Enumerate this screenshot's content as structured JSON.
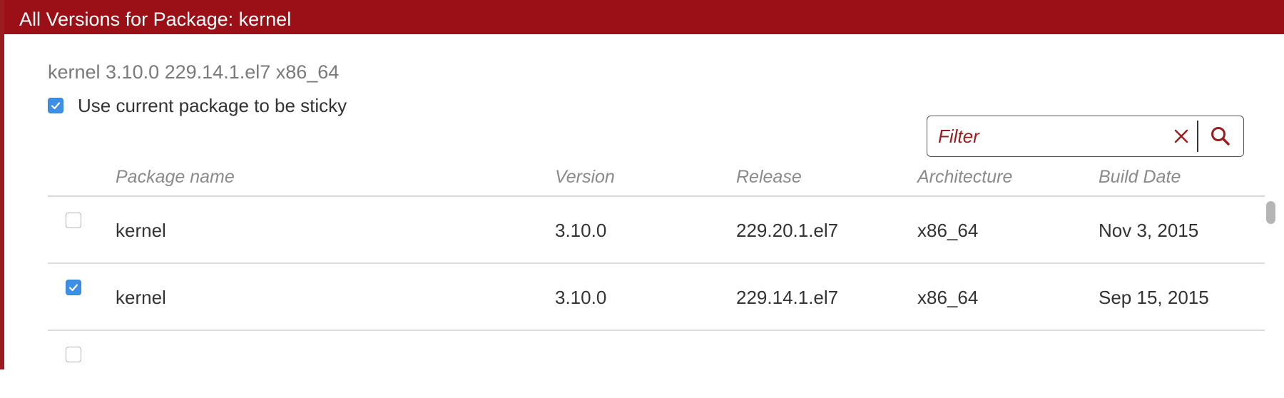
{
  "dialog": {
    "title": "All Versions for Package: kernel",
    "subtitle": "kernel 3.10.0 229.14.1.el7 x86_64",
    "sticky_label": "Use current package to be sticky",
    "sticky_checked": true
  },
  "filter": {
    "placeholder": "Filter",
    "value": "",
    "clear_icon": "close-icon",
    "search_icon": "search-icon"
  },
  "table": {
    "columns": [
      "Package name",
      "Version",
      "Release",
      "Architecture",
      "Build Date"
    ],
    "rows": [
      {
        "checked": false,
        "name": "kernel",
        "version": "3.10.0",
        "release": "229.20.1.el7",
        "arch": "x86_64",
        "build_date": "Nov 3, 2015"
      },
      {
        "checked": true,
        "name": "kernel",
        "version": "3.10.0",
        "release": "229.14.1.el7",
        "arch": "x86_64",
        "build_date": "Sep 15, 2015"
      },
      {
        "checked": false,
        "name": "",
        "version": "",
        "release": "",
        "arch": "",
        "build_date": ""
      }
    ]
  },
  "colors": {
    "title_bar": "#9b1016",
    "accent": "#9b1c1f",
    "checkbox_checked": "#3d8ee6"
  }
}
